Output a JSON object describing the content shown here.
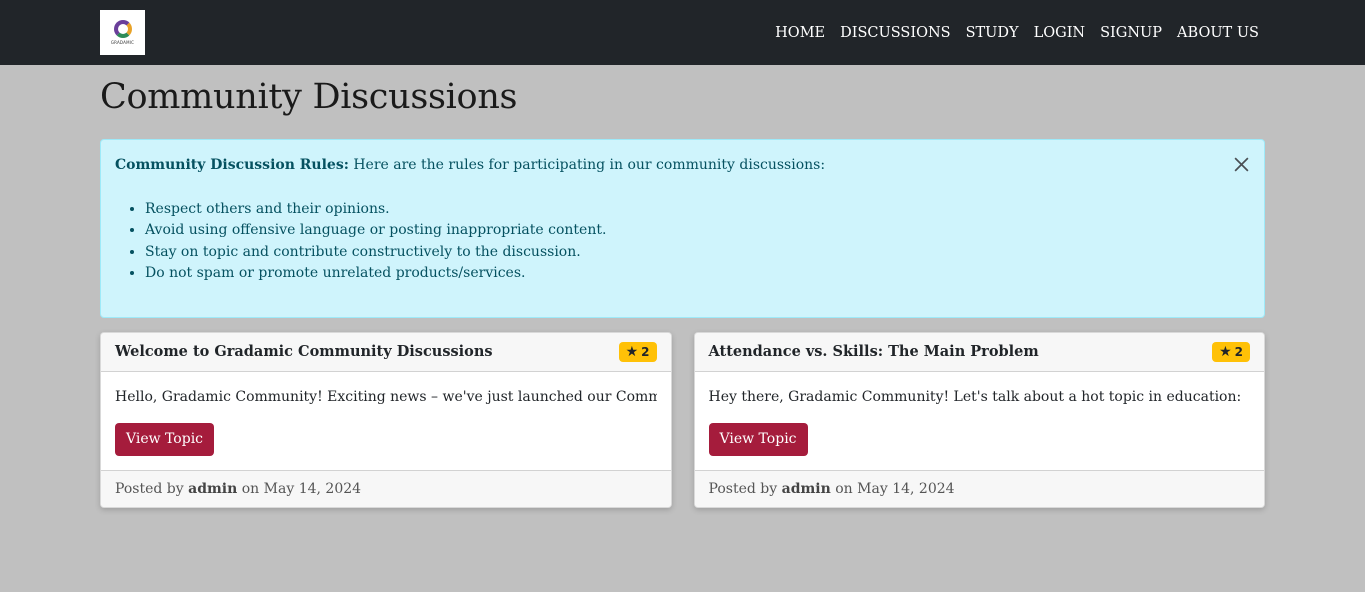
{
  "nav": {
    "logo_text": "GRADAMIC",
    "links": [
      "HOME",
      "DISCUSSIONS",
      "STUDY",
      "LOGIN",
      "SIGNUP",
      "ABOUT US"
    ]
  },
  "page": {
    "title": "Community Discussions"
  },
  "alert": {
    "title": "Community Discussion Rules:",
    "intro": "Here are the rules for participating in our community discussions:",
    "rules": [
      "Respect others and their opinions.",
      "Avoid using offensive language or posting inappropriate content.",
      "Stay on topic and contribute constructively to the discussion.",
      "Do not spam or promote unrelated products/services."
    ]
  },
  "topics": [
    {
      "title": "Welcome to Gradamic Community Discussions",
      "stars": "2",
      "excerpt": "Hello, Gradamic Community! Exciting news – we've just launched our Community",
      "button": "View Topic",
      "posted_by_label": "Posted by",
      "author": "admin",
      "on_label": "on",
      "date": "May 14, 2024"
    },
    {
      "title": "Attendance vs. Skills: The Main Problem",
      "stars": "2",
      "excerpt": "Hey there, Gradamic Community! Let's talk about a hot topic in education:",
      "button": "View Topic",
      "posted_by_label": "Posted by",
      "author": "admin",
      "on_label": "on",
      "date": "May 14, 2024"
    }
  ],
  "colors": {
    "navbar": "#212529",
    "page_bg": "#c0c0c0",
    "alert_bg": "#cff4fc",
    "badge": "#ffc107",
    "button": "#a51c3c"
  }
}
